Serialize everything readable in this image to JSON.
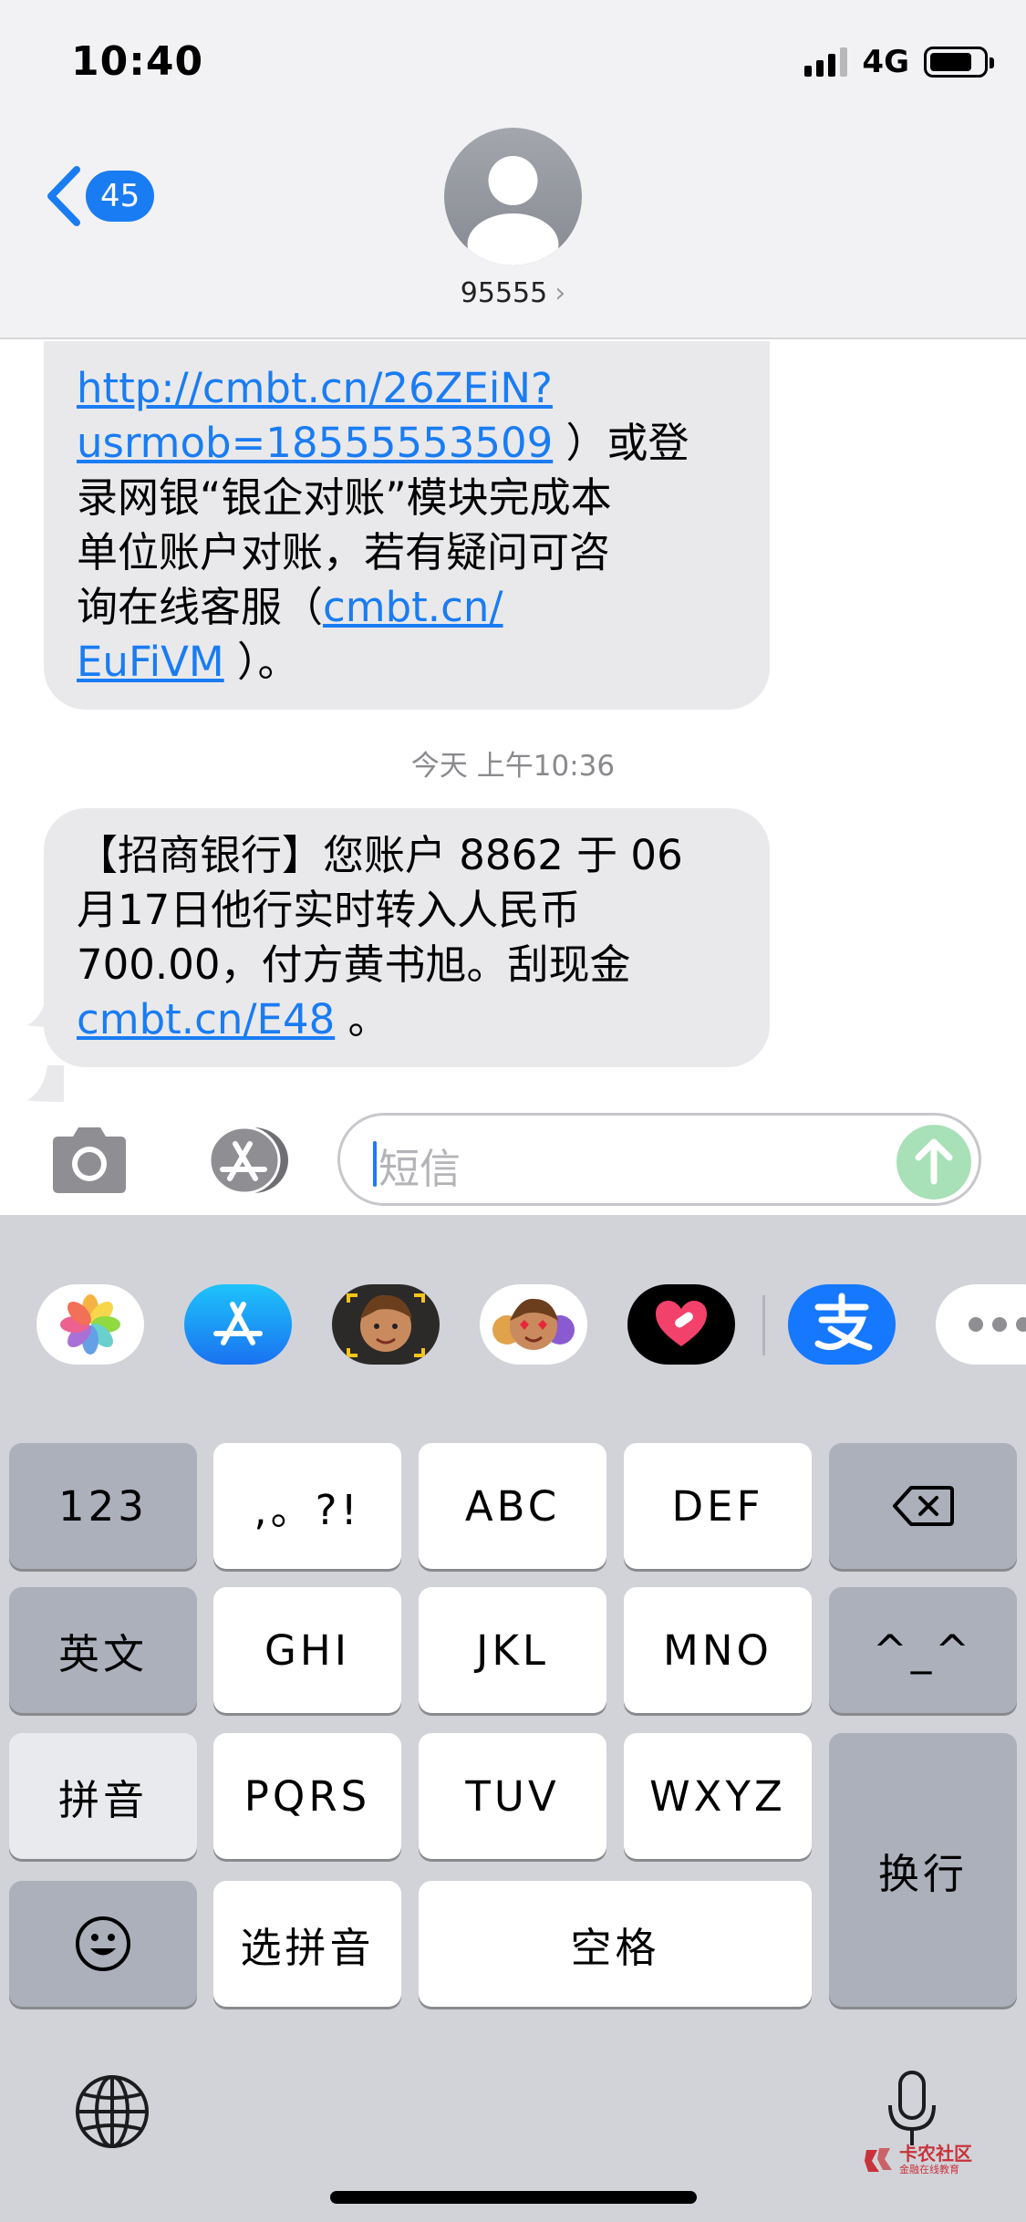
{
  "status_bar": {
    "time": "10:40",
    "network": "4G",
    "battery_level": 0.8
  },
  "nav": {
    "unread_count": "45",
    "contact_name": "95555",
    "contact_chevron": "›"
  },
  "messages": [
    {
      "segments": [
        {
          "type": "link",
          "text": "http://cmbt.cn/26ZEiN?"
        },
        {
          "type": "break"
        },
        {
          "type": "link",
          "text": "usrmob=18555553509"
        },
        {
          "type": "text",
          "text": " ）或登"
        },
        {
          "type": "break"
        },
        {
          "type": "text",
          "text": "录网银“银企对账”模块完成本"
        },
        {
          "type": "break"
        },
        {
          "type": "text",
          "text": "单位账户对账，若有疑问可咨"
        },
        {
          "type": "break"
        },
        {
          "type": "text",
          "text": "询在线客服（"
        },
        {
          "type": "link",
          "text": "cmbt.cn/"
        },
        {
          "type": "break"
        },
        {
          "type": "link",
          "text": "EuFiVM"
        },
        {
          "type": "text",
          "text": " ）。"
        }
      ]
    },
    {
      "segments": [
        {
          "type": "text",
          "text": "【招商银行】您账户 8862 于 06"
        },
        {
          "type": "break"
        },
        {
          "type": "text",
          "text": "月17日他行实时转入人民币"
        },
        {
          "type": "break"
        },
        {
          "type": "text",
          "text": "700.00，付方黄书旭。刮现金"
        },
        {
          "type": "break"
        },
        {
          "type": "link",
          "text": "cmbt.cn/E48"
        },
        {
          "type": "text",
          "text": " 。"
        }
      ]
    }
  ],
  "timestamp": "今天 上午10:36",
  "composer": {
    "placeholder": "短信"
  },
  "drawer_apps": [
    "photos-app",
    "app-store-app",
    "memoji-app",
    "animoji-app",
    "digital-touch-app",
    "alipay-app",
    "more-apps"
  ],
  "keyboard": {
    "row1": {
      "numbers": "123",
      "punct": ",。?!",
      "abc": "ABC",
      "def": "DEF",
      "delete_icon": "backspace-icon"
    },
    "row2": {
      "english": "英文",
      "ghi": "GHI",
      "jkl": "JKL",
      "mno": "MNO",
      "emoticon": "^_^"
    },
    "row3": {
      "pinyin": "拼音",
      "pqrs": "PQRS",
      "tuv": "TUV",
      "wxyz": "WXYZ",
      "return": "换行"
    },
    "row4": {
      "emoji_icon": "smiley-icon",
      "select_pinyin": "选拼音",
      "space": "空格"
    }
  },
  "watermark": {
    "title": "卡农社区",
    "subtitle": "金融在线教育"
  },
  "colors": {
    "link": "#1a7cf3",
    "bubble": "#e9e9eb",
    "keyboard_bg": "#d1d3d9",
    "send_disabled": "#a8e0b7"
  }
}
